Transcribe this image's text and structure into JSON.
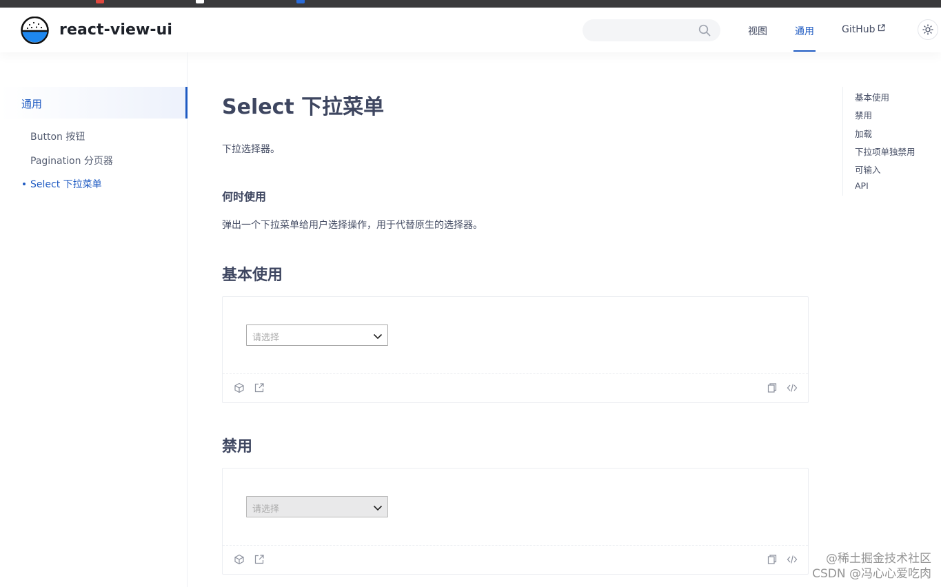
{
  "site": {
    "title": "react-view-ui"
  },
  "search": {
    "placeholder": ""
  },
  "nav": {
    "view": "视图",
    "general": "通用",
    "github": "GitHub"
  },
  "sidebar": {
    "group": "通用",
    "items": [
      {
        "label": "Button 按钮"
      },
      {
        "label": "Pagination 分页器"
      },
      {
        "label": "Select 下拉菜单"
      }
    ]
  },
  "page": {
    "title": "Select 下拉菜单",
    "intro": "下拉选择器。",
    "when_title": "何时使用",
    "when_text": "弹出一个下拉菜单给用户选择操作，用于代替原生的选择器。"
  },
  "sections": [
    {
      "title": "基本使用",
      "select_placeholder": "请选择",
      "disabled": false
    },
    {
      "title": "禁用",
      "select_placeholder": "请选择",
      "disabled": true
    }
  ],
  "toc": [
    "基本使用",
    "禁用",
    "加载",
    "下拉项单独禁用",
    "可输入",
    "API"
  ],
  "watermark": {
    "line1": "@稀土掘金技术社区",
    "line2": "CSDN @冯心心爱吃肉"
  },
  "colors": {
    "accent": "#1e5ac2",
    "text": "#454d64",
    "heading": "#3e4660"
  },
  "icons": {
    "search": "search-icon",
    "external": "external-link-icon",
    "theme": "sun-icon",
    "codesandbox": "codesandbox-icon",
    "open": "open-external-icon",
    "copy": "copy-icon",
    "code": "code-icon",
    "chevron": "chevron-down-icon"
  }
}
